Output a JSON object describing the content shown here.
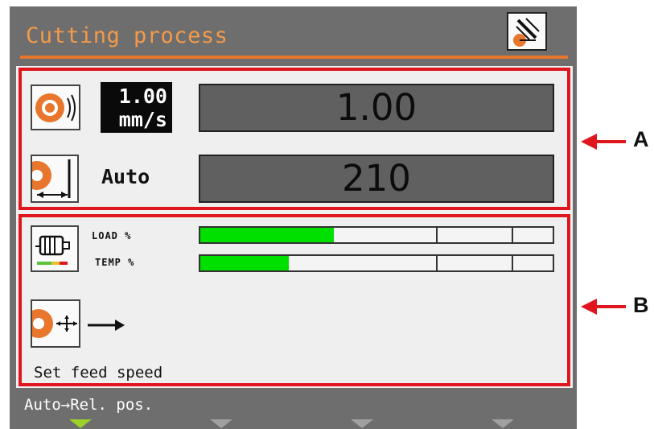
{
  "header": {
    "title": "Cutting process",
    "mode_icon": "cutting-mode-icon"
  },
  "section_a": {
    "callout": "A",
    "feed_speed": {
      "icon": "feed-speed-icon",
      "setpoint": "1.00\nmm/s",
      "value": "1.00"
    },
    "position": {
      "icon": "distance-icon",
      "mode": "Auto",
      "value": "210"
    }
  },
  "section_b": {
    "callout": "B",
    "motor_icon": "motor-icon",
    "load": {
      "label": "LOAD %",
      "percent": 38
    },
    "temp": {
      "label": "TEMP %",
      "percent": 25
    },
    "feed_action": {
      "icon": "feed-move-icon",
      "arrow_icon": "right-arrow-icon"
    },
    "status": "Set feed speed"
  },
  "footer": {
    "softkey_label": "Auto→Rel. pos.",
    "softkeys": [
      "softkey-1",
      "softkey-2",
      "softkey-3",
      "softkey-4"
    ]
  },
  "colors": {
    "accent": "#e8762d",
    "highlight": "#e0161e",
    "bar_fill": "#00e000",
    "screen": "#6e6e6e"
  }
}
